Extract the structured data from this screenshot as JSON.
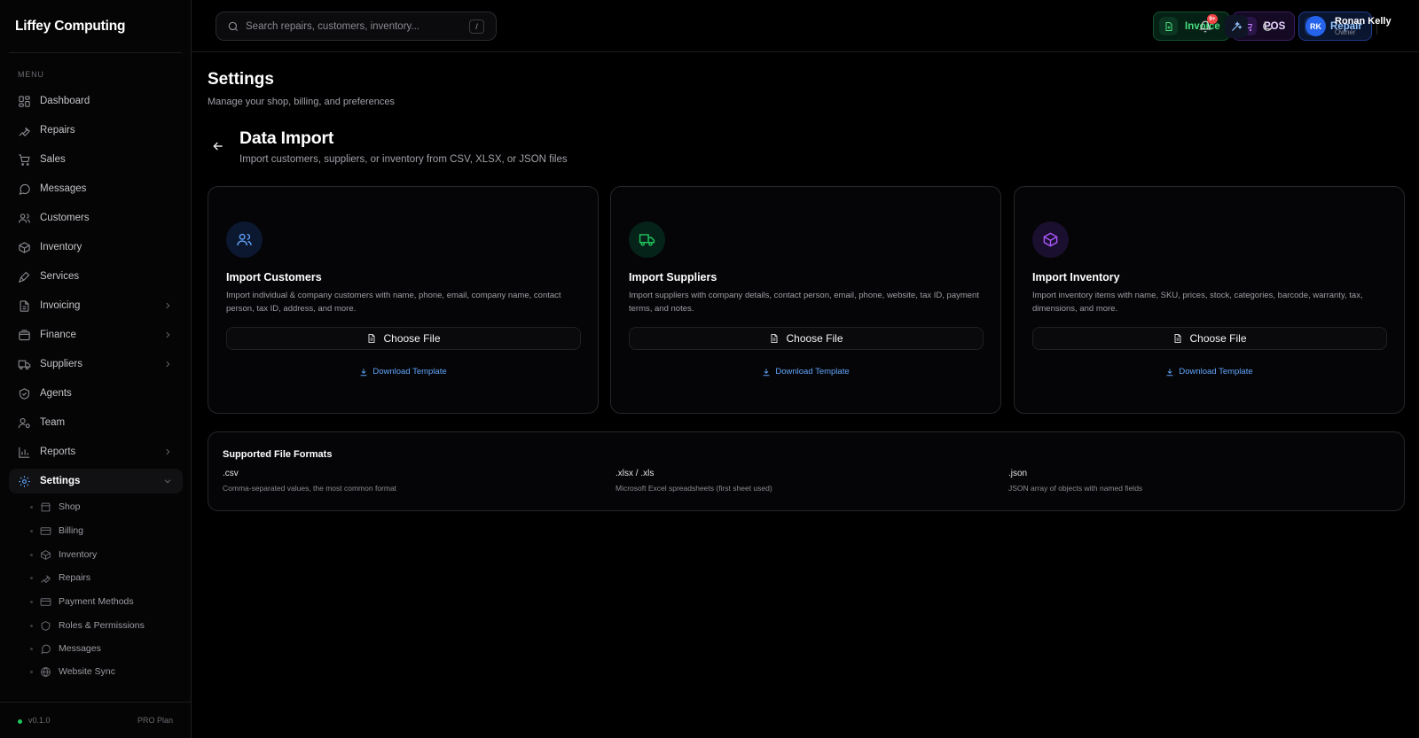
{
  "app": {
    "name": "Liffey Computing"
  },
  "sidebar": {
    "menu_label": "MENU",
    "items": [
      {
        "label": "Dashboard",
        "icon": "dashboard-icon"
      },
      {
        "label": "Repairs",
        "icon": "wrench-icon"
      },
      {
        "label": "Sales",
        "icon": "cart-icon"
      },
      {
        "label": "Messages",
        "icon": "message-icon"
      },
      {
        "label": "Customers",
        "icon": "users-icon"
      },
      {
        "label": "Inventory",
        "icon": "box-icon"
      },
      {
        "label": "Services",
        "icon": "tool-icon"
      },
      {
        "label": "Invoicing",
        "icon": "invoice-icon",
        "expandable": true
      },
      {
        "label": "Finance",
        "icon": "wallet-icon",
        "expandable": true
      },
      {
        "label": "Suppliers",
        "icon": "truck-icon",
        "expandable": true
      },
      {
        "label": "Agents",
        "icon": "agent-icon"
      },
      {
        "label": "Team",
        "icon": "team-icon"
      },
      {
        "label": "Reports",
        "icon": "chart-icon",
        "expandable": true
      },
      {
        "label": "Settings",
        "icon": "gear-icon",
        "expanded": true,
        "active": true
      }
    ],
    "settings_subitems": [
      {
        "label": "Shop"
      },
      {
        "label": "Billing"
      },
      {
        "label": "Inventory"
      },
      {
        "label": "Repairs"
      },
      {
        "label": "Payment Methods"
      },
      {
        "label": "Roles & Permissions"
      },
      {
        "label": "Messages"
      },
      {
        "label": "Website Sync"
      }
    ],
    "footer": {
      "version": "v0.1.0",
      "plan": "PRO Plan",
      "status_color": "#22c55e"
    }
  },
  "topbar": {
    "search": {
      "placeholder": "Search repairs, customers, inventory...",
      "shortcut": "/"
    },
    "quick_actions": [
      {
        "label": "Invoice",
        "icon": "invoice-icon",
        "color": "#4ade80"
      },
      {
        "label": "POS",
        "icon": "cart-icon",
        "color": "#c084fc"
      },
      {
        "label": "Repair",
        "icon": "wrench-icon",
        "color": "#60a5fa"
      }
    ],
    "notifications": {
      "badge": "9+"
    },
    "user": {
      "initials": "RK",
      "name": "Ronan Kelly",
      "role": "Owner"
    }
  },
  "page": {
    "title": "Settings",
    "subtitle": "Manage your shop, billing, and preferences"
  },
  "section": {
    "title": "Data Import",
    "subtitle": "Import customers, suppliers, or inventory from CSV, XLSX, or JSON files"
  },
  "cards": [
    {
      "title": "Import Customers",
      "description": "Import individual & company customers with name, phone, email, company name, contact person, tax ID, address, and more.",
      "button": "Choose File",
      "link": "Download Template",
      "icon": "users-icon",
      "accent": "#60a5fa"
    },
    {
      "title": "Import Suppliers",
      "description": "Import suppliers with company details, contact person, email, phone, website, tax ID, payment terms, and notes.",
      "button": "Choose File",
      "link": "Download Template",
      "icon": "truck-icon",
      "accent": "#22c55e"
    },
    {
      "title": "Import Inventory",
      "description": "Import inventory items with name, SKU, prices, stock, categories, barcode, warranty, tax, dimensions, and more.",
      "button": "Choose File",
      "link": "Download Template",
      "icon": "box-icon",
      "accent": "#a855f7"
    }
  ],
  "formats": {
    "title": "Supported File Formats",
    "items": [
      {
        "name": ".csv",
        "description": "Comma-separated values, the most common format"
      },
      {
        "name": ".xlsx / .xls",
        "description": "Microsoft Excel spreadsheets (first sheet used)"
      },
      {
        "name": ".json",
        "description": "JSON array of objects with named fields"
      }
    ]
  }
}
